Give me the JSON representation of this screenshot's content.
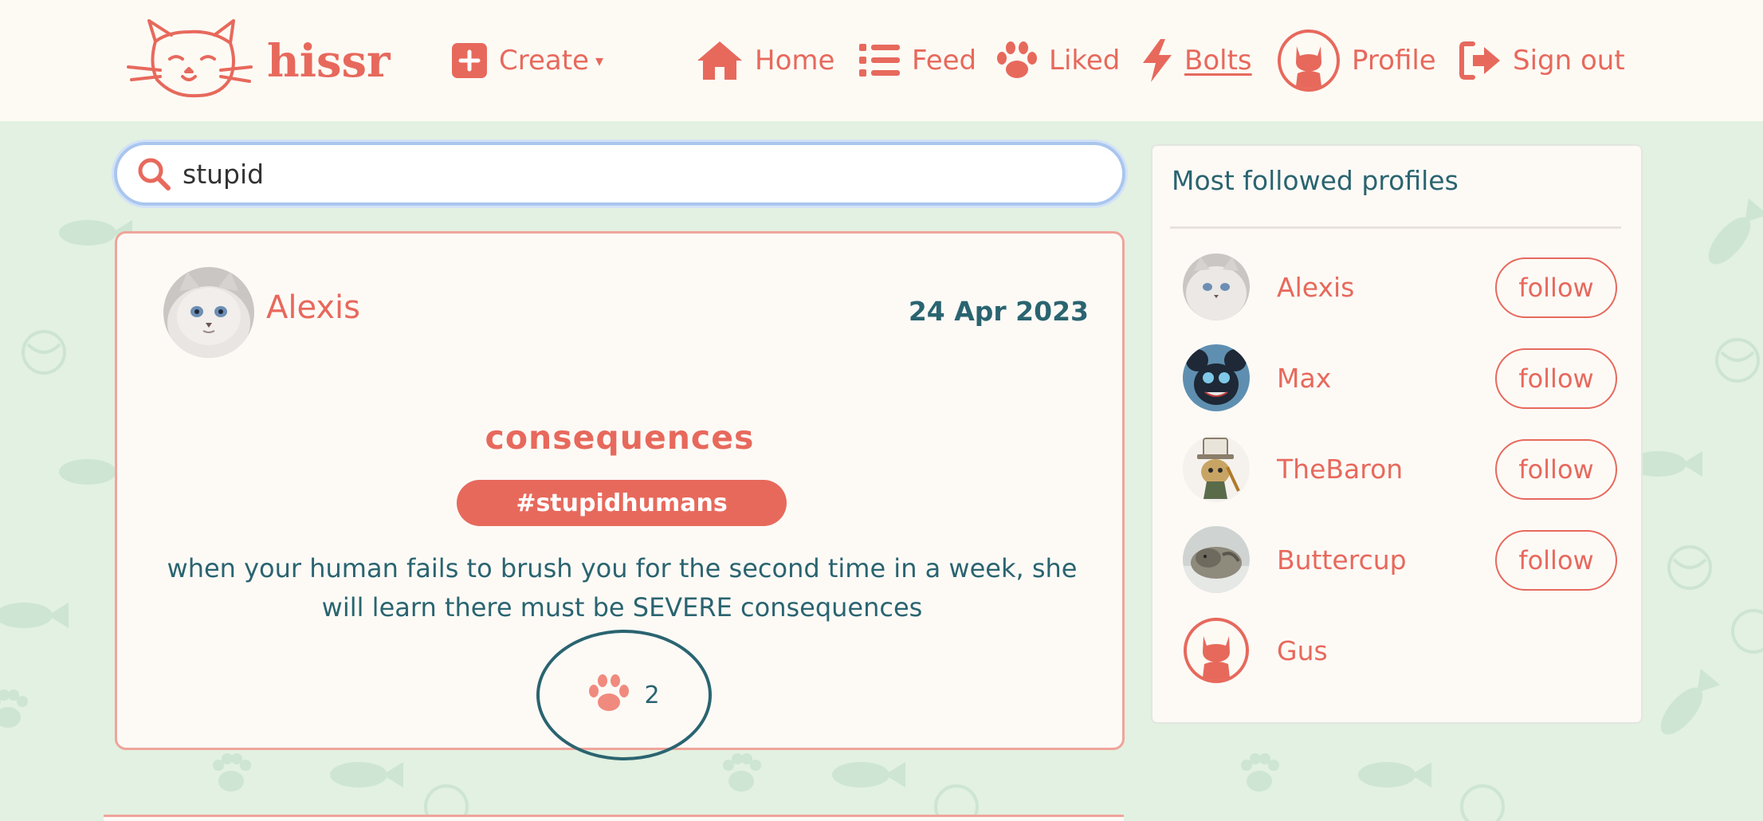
{
  "app": {
    "brand_name": "hissr",
    "accent": "#e7695c",
    "text_color": "#2a6470"
  },
  "nav": {
    "create": {
      "label": "Create",
      "icon": "plus-square-icon"
    },
    "home": {
      "label": "Home",
      "icon": "home-icon"
    },
    "feed": {
      "label": "Feed",
      "icon": "list-icon"
    },
    "liked": {
      "label": "Liked",
      "icon": "paw-icon"
    },
    "bolts": {
      "label": "Bolts",
      "icon": "bolt-icon"
    },
    "profile": {
      "label": "Profile",
      "icon": "cat-avatar-icon"
    },
    "signout": {
      "label": "Sign out",
      "icon": "sign-out-icon"
    }
  },
  "search": {
    "value": "stupid",
    "icon": "search-icon"
  },
  "post": {
    "author": "Alexis",
    "date": "24 Apr 2023",
    "title": "consequences",
    "tag": "#stupidhumans",
    "body": "when your human fails to brush you for the second time in a week, she will learn there must be SEVERE consequences",
    "likes": "2"
  },
  "sidebar": {
    "heading": "Most followed profiles",
    "profiles": [
      {
        "name": "Alexis",
        "action": "follow"
      },
      {
        "name": "Max",
        "action": "follow"
      },
      {
        "name": "TheBaron",
        "action": "follow"
      },
      {
        "name": "Buttercup",
        "action": "follow"
      },
      {
        "name": "Gus"
      }
    ]
  }
}
